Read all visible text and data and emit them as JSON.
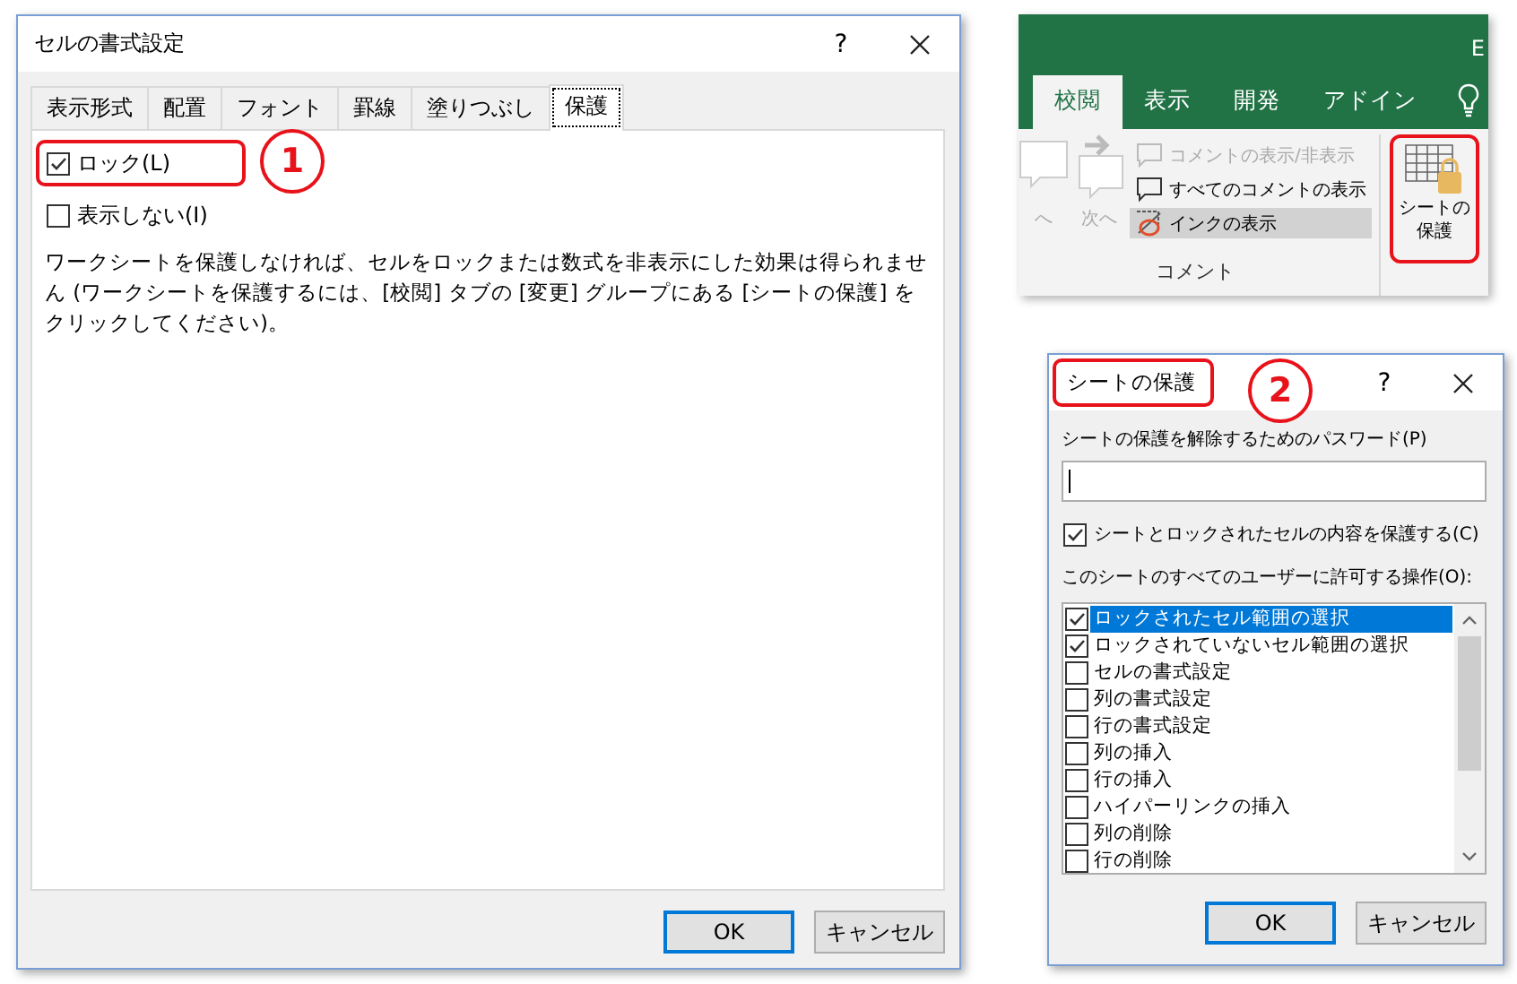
{
  "format_cells_dialog": {
    "title": "セルの書式設定",
    "help": "?",
    "tabs": [
      {
        "label": "表示形式",
        "selected": false
      },
      {
        "label": "配置",
        "selected": false
      },
      {
        "label": "フォント",
        "selected": false
      },
      {
        "label": "罫線",
        "selected": false
      },
      {
        "label": "塗りつぶし",
        "selected": false
      },
      {
        "label": "保護",
        "selected": true
      }
    ],
    "options": [
      {
        "label": "ロック(L)",
        "checked": true,
        "highlighted": true
      },
      {
        "label": "表示しない(I)",
        "checked": false,
        "highlighted": false
      }
    ],
    "note": "ワークシートを保護しなければ、セルをロックまたは数式を非表示にした効果は得られません (ワークシートを保護するには、[校閲] タブの [変更] グループにある [シートの保護] をクリックしてください)。",
    "buttons": [
      {
        "label": "OK",
        "default": true
      },
      {
        "label": "キャンセル",
        "default": false
      }
    ],
    "callout": "1"
  },
  "ribbon": {
    "title": "E",
    "tabs": [
      {
        "label": "校閲",
        "selected": true
      },
      {
        "label": "表示",
        "selected": false
      },
      {
        "label": "開発",
        "selected": false
      },
      {
        "label": "アドイン",
        "selected": false
      }
    ],
    "nav_buttons": [
      {
        "label": "へ",
        "disabled": true
      },
      {
        "label": "次へ",
        "disabled": true
      }
    ],
    "commands": [
      {
        "label": "コメントの表示/非表示",
        "disabled": true,
        "selected": false
      },
      {
        "label": "すべてのコメントの表示",
        "disabled": false,
        "selected": false
      },
      {
        "label": "インクの表示",
        "disabled": false,
        "selected": true
      }
    ],
    "group_label": "コメント",
    "protect_button": {
      "label": "シートの保護",
      "highlighted": true
    }
  },
  "protect_sheet_dialog": {
    "title": "シートの保護",
    "title_highlighted": true,
    "help": "?",
    "password_label": "シートの保護を解除するためのパスワード(P)",
    "protect_option": {
      "label": "シートとロックされたセルの内容を保護する(C)",
      "checked": true
    },
    "permissions_label": "このシートのすべてのユーザーに許可する操作(O):",
    "permissions": [
      {
        "label": "ロックされたセル範囲の選択",
        "checked": true,
        "selected": true
      },
      {
        "label": "ロックされていないセル範囲の選択",
        "checked": true,
        "selected": false
      },
      {
        "label": "セルの書式設定",
        "checked": false,
        "selected": false
      },
      {
        "label": "列の書式設定",
        "checked": false,
        "selected": false
      },
      {
        "label": "行の書式設定",
        "checked": false,
        "selected": false
      },
      {
        "label": "列の挿入",
        "checked": false,
        "selected": false
      },
      {
        "label": "行の挿入",
        "checked": false,
        "selected": false
      },
      {
        "label": "ハイパーリンクの挿入",
        "checked": false,
        "selected": false
      },
      {
        "label": "列の削除",
        "checked": false,
        "selected": false
      },
      {
        "label": "行の削除",
        "checked": false,
        "selected": false
      }
    ],
    "buttons": [
      {
        "label": "OK",
        "default": true
      },
      {
        "label": "キャンセル",
        "default": false
      }
    ],
    "callout": "2"
  }
}
